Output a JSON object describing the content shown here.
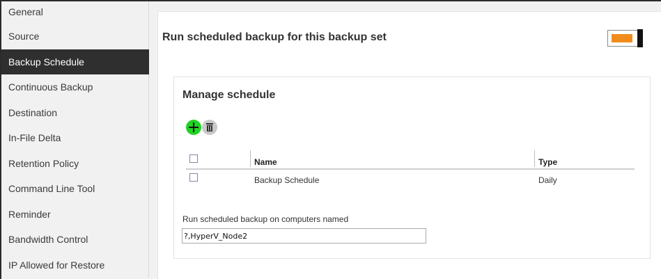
{
  "sidebar": {
    "items": [
      {
        "label": "General"
      },
      {
        "label": "Source"
      },
      {
        "label": "Backup Schedule",
        "active": true
      },
      {
        "label": "Continuous Backup"
      },
      {
        "label": "Destination"
      },
      {
        "label": "In-File Delta"
      },
      {
        "label": "Retention Policy"
      },
      {
        "label": "Command Line Tool"
      },
      {
        "label": "Reminder"
      },
      {
        "label": "Bandwidth Control"
      },
      {
        "label": "IP Allowed for Restore"
      }
    ]
  },
  "main": {
    "title": "Run scheduled backup for this backup set",
    "toggle": {
      "state": "on",
      "color": "#f08c1c"
    }
  },
  "manage": {
    "title": "Manage schedule",
    "icons": {
      "add": "add-icon",
      "delete": "trash-icon"
    },
    "columns": {
      "name": "Name",
      "type": "Type"
    },
    "rows": [
      {
        "name": "Backup Schedule",
        "type": "Daily"
      }
    ],
    "computers_label": "Run scheduled backup on computers named",
    "computers_value": "?,HyperV_Node2"
  },
  "colors": {
    "active_bg": "#2f2f2f",
    "accent_orange": "#f08c1c",
    "add_green": "#22d324"
  }
}
